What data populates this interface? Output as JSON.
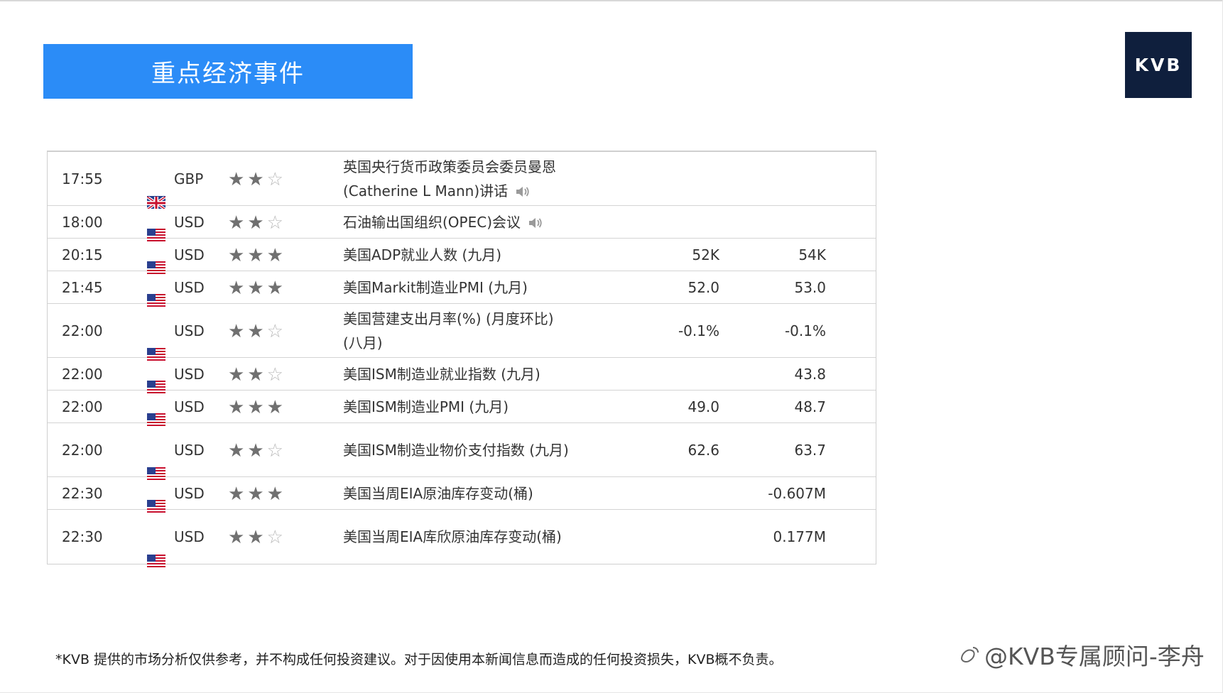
{
  "banner": {
    "title": "重点经济事件"
  },
  "logo": {
    "text": "KVB"
  },
  "colors": {
    "banner": "#2b8cf7",
    "logo_bg": "#0f1f3d"
  },
  "events": [
    {
      "time": "17:55",
      "flag": "uk-flag-icon",
      "currency": "GBP",
      "stars": 2,
      "event": "英国央行货币政策委员会委员曼恩(Catherine L Mann)讲话",
      "speaker": true,
      "previous": "",
      "forecast": ""
    },
    {
      "time": "18:00",
      "flag": "us-flag-icon",
      "currency": "USD",
      "stars": 2,
      "event": "石油输出国组织(OPEC)会议",
      "speaker": true,
      "previous": "",
      "forecast": ""
    },
    {
      "time": "20:15",
      "flag": "us-flag-icon",
      "currency": "USD",
      "stars": 3,
      "event": "美国ADP就业人数 (九月)",
      "speaker": false,
      "previous": "52K",
      "forecast": "54K"
    },
    {
      "time": "21:45",
      "flag": "us-flag-icon",
      "currency": "USD",
      "stars": 3,
      "event": "美国Markit制造业PMI (九月)",
      "speaker": false,
      "previous": "52.0",
      "forecast": "53.0"
    },
    {
      "time": "22:00",
      "flag": "us-flag-icon",
      "currency": "USD",
      "stars": 2,
      "event": "美国营建支出月率(%) (月度环比) (八月)",
      "speaker": false,
      "previous": "-0.1%",
      "forecast": "-0.1%"
    },
    {
      "time": "22:00",
      "flag": "us-flag-icon",
      "currency": "USD",
      "stars": 2,
      "event": "美国ISM制造业就业指数 (九月)",
      "speaker": false,
      "previous": "",
      "forecast": "43.8"
    },
    {
      "time": "22:00",
      "flag": "us-flag-icon",
      "currency": "USD",
      "stars": 3,
      "event": "美国ISM制造业PMI (九月)",
      "speaker": false,
      "previous": "49.0",
      "forecast": "48.7"
    },
    {
      "time": "22:00",
      "flag": "us-flag-icon",
      "currency": "USD",
      "stars": 2,
      "event": "美国ISM制造业物价支付指数 (九月)",
      "speaker": false,
      "previous": "62.6",
      "forecast": "63.7"
    },
    {
      "time": "22:30",
      "flag": "us-flag-icon",
      "currency": "USD",
      "stars": 3,
      "event": "美国当周EIA原油库存变动(桶)",
      "speaker": false,
      "previous": "",
      "forecast": "-0.607M"
    },
    {
      "time": "22:30",
      "flag": "us-flag-icon",
      "currency": "USD",
      "stars": 2,
      "event": "美国当周EIA库欣原油库存变动(桶)",
      "speaker": false,
      "previous": "",
      "forecast": "0.177M"
    }
  ],
  "disclaimer": "*KVB 提供的市场分析仅供参考，并不构成任何投资建议。对于因使用本新闻信息而造成的任何投资损失，KVB概不负责。",
  "watermark": "@KVB专属顾问-李舟"
}
